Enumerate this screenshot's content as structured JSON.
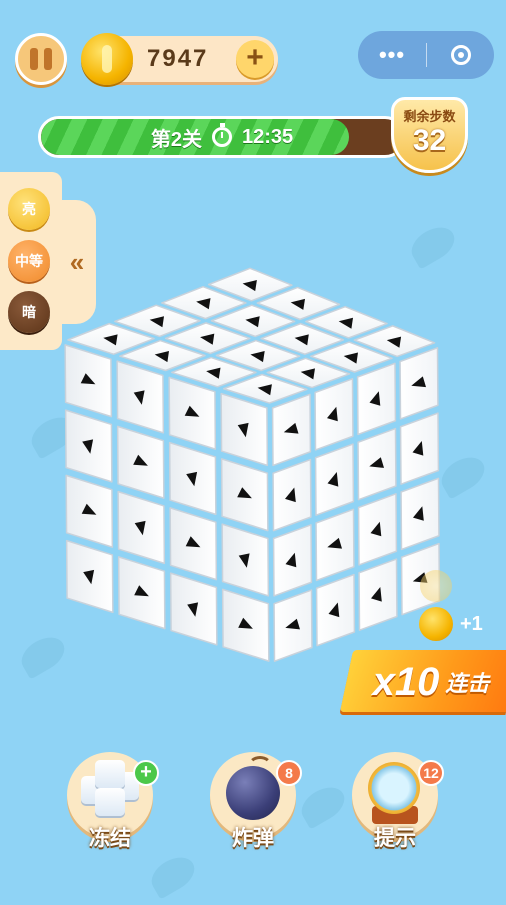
{
  "header": {
    "coins": "7947",
    "coin_plus": "+",
    "capsule_menu": "•••"
  },
  "level": {
    "label": "第2关",
    "timer": "12:35",
    "progress_fraction": 0.85
  },
  "steps": {
    "label": "剩余步数",
    "value": "32"
  },
  "brightness": {
    "options": [
      "亮",
      "中等",
      "暗"
    ],
    "collapse_glyph": "«"
  },
  "combo": {
    "plus_coins": "+1",
    "multiplier": "x10",
    "label": "连击"
  },
  "tools": [
    {
      "label": "冻结",
      "badge": "+"
    },
    {
      "label": "炸弹",
      "badge": "8"
    },
    {
      "label": "提示",
      "badge": "12"
    }
  ],
  "colors": {
    "background": "#8fd3f5",
    "progress_green": "#4cc94a",
    "accent_orange": "#ff9a1a",
    "badge_red": "#f47a4a"
  },
  "icons": [
    "pause-icon",
    "coin-icon",
    "plus-icon",
    "more-icon",
    "target-icon",
    "stopwatch-icon",
    "chevron-double-left-icon",
    "ice-cube-icon",
    "bomb-icon",
    "magnifier-icon"
  ]
}
